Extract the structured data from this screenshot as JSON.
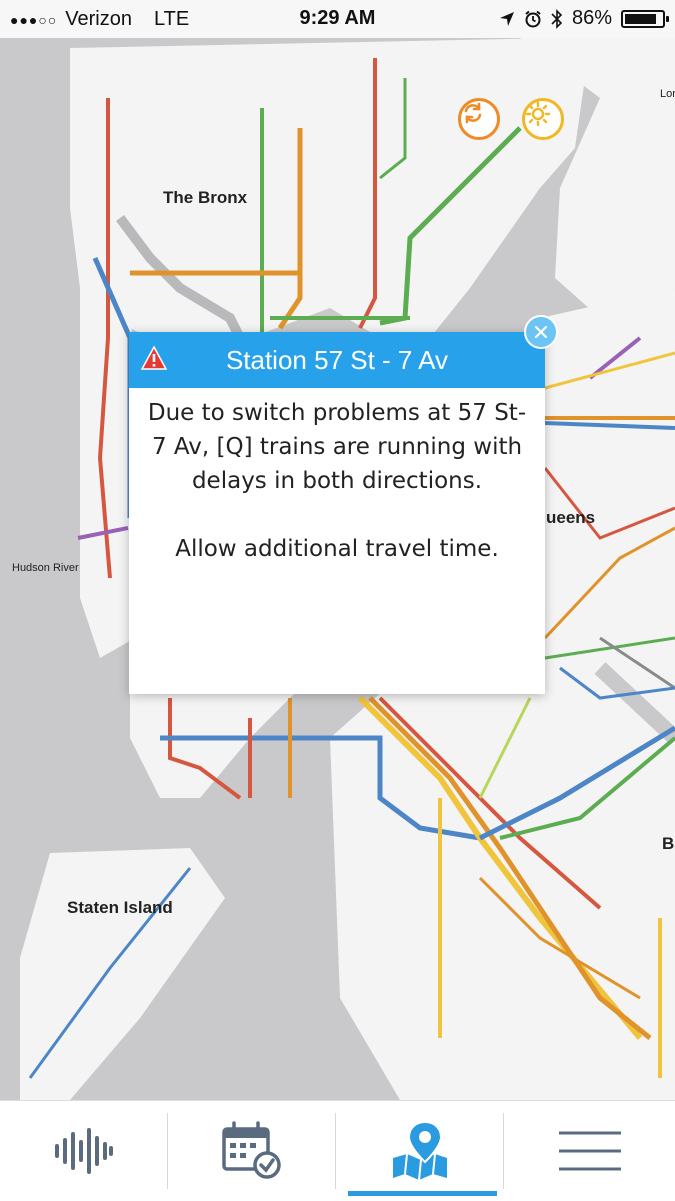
{
  "status_bar": {
    "carrier": "Verizon",
    "network": "LTE",
    "time": "9:29 AM",
    "battery": "86%",
    "battery_level": 0.86
  },
  "map": {
    "labels": {
      "bronx": "The Bronx",
      "queens": "ueens",
      "staten_island": "Staten Island",
      "hudson_river": "Hudson River",
      "lon": "Lon",
      "b": "B"
    }
  },
  "alert": {
    "title": "Station 57 St - 7 Av",
    "message": "Due to switch problems at 57 St-7 Av, [Q] trains are running with delays in both directions.",
    "note": "Allow additional travel time."
  },
  "colors": {
    "accent": "#27a2ea",
    "warning": "#e53935",
    "refresh": "#f08a24",
    "brightness": "#f2b824"
  },
  "icons": {
    "refresh": "refresh-icon",
    "brightness": "brightness-icon",
    "close": "close-icon",
    "warning": "warning-icon",
    "tabs": [
      "sound-wave-icon",
      "calendar-check-icon",
      "map-pin-icon",
      "menu-icon"
    ]
  }
}
